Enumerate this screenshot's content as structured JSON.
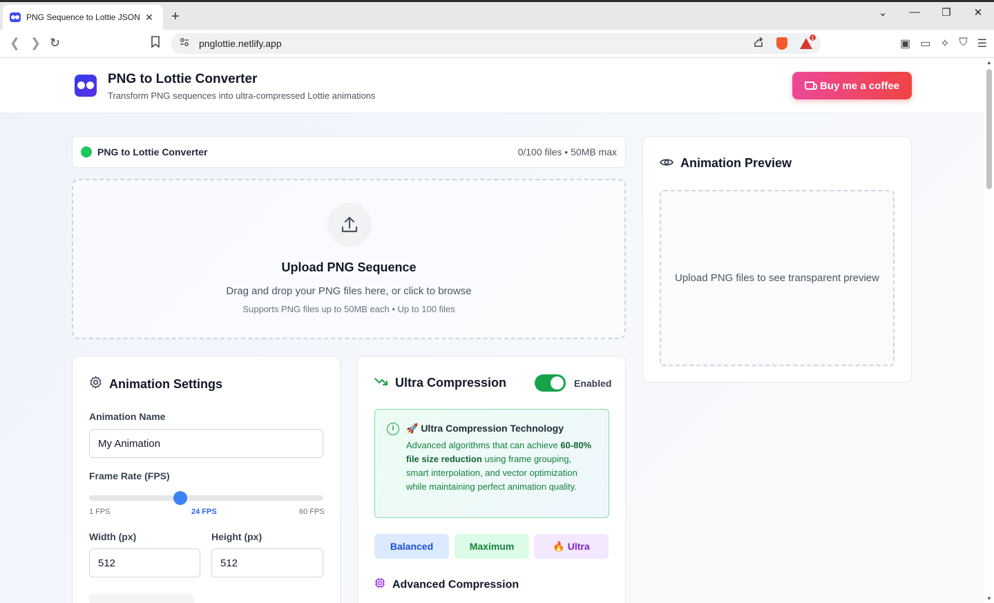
{
  "browser": {
    "tab_title": "PNG Sequence to Lottie JSON C",
    "url": "pnglottie.netlify.app",
    "shield_badge": "1"
  },
  "header": {
    "title": "PNG to Lottie Converter",
    "subtitle": "Transform PNG sequences into ultra-compressed Lottie animations",
    "coffee_label": "Buy me a coffee"
  },
  "status": {
    "name": "PNG to Lottie Converter",
    "info": "0/100 files • 50MB max",
    "color": "#22c55e"
  },
  "upload": {
    "title": "Upload PNG Sequence",
    "text": "Drag and drop your PNG files here, or click to browse",
    "note": "Supports PNG files up to 50MB each • Up to 100 files"
  },
  "preview": {
    "title": "Animation Preview",
    "placeholder": "Upload PNG files to see transparent preview"
  },
  "settings": {
    "title": "Animation Settings",
    "name_label": "Animation Name",
    "name_value": "My Animation",
    "fps_label": "Frame Rate (FPS)",
    "fps_min_label": "1 FPS",
    "fps_current_label": "24 FPS",
    "fps_max_label": "60 FPS",
    "fps_min": 1,
    "fps_max": 60,
    "fps_value": 24,
    "width_label": "Width (px)",
    "width_value": "512",
    "height_label": "Height (px)",
    "height_value": "512"
  },
  "compression": {
    "title": "Ultra Compression",
    "toggle_label": "Enabled",
    "toggle_on": true,
    "info_title": "🚀 Ultra Compression Technology",
    "info_pre": "Advanced algorithms that can achieve ",
    "info_bold": "60-80% file size reduction",
    "info_post": " using frame grouping, smart interpolation, and vector optimization while maintaining perfect animation quality.",
    "presets": [
      "Balanced",
      "Maximum",
      "🔥 Ultra"
    ],
    "advanced_title": "Advanced Compression"
  },
  "colors": {
    "accent": "#3b82f6",
    "success": "#16a34a",
    "coffee_gradient_start": "#ec4899",
    "coffee_gradient_end": "#ef4444"
  }
}
